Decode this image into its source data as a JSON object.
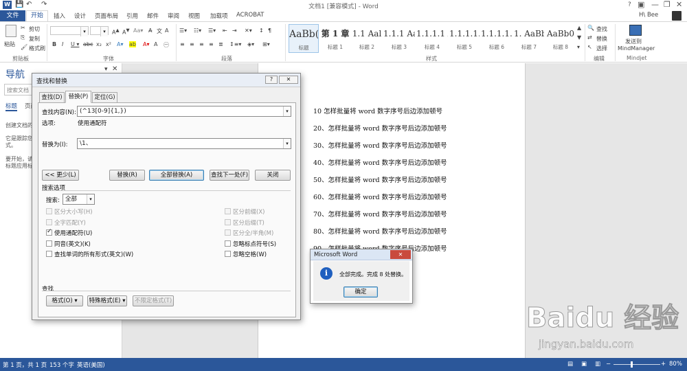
{
  "window": {
    "title": "文档1 [兼容模式] - Word",
    "help": "?",
    "user": "H\\ Bee"
  },
  "tabs": [
    "文件",
    "开始",
    "插入",
    "设计",
    "页面布局",
    "引用",
    "邮件",
    "审阅",
    "视图",
    "加载项",
    "ACROBAT"
  ],
  "ribbon": {
    "clipboard": {
      "paste": "粘贴",
      "cut": "剪切",
      "copy": "复制",
      "format_painter": "格式刷",
      "label": "剪贴板"
    },
    "font": {
      "size": "",
      "label": "字体"
    },
    "paragraph": {
      "label": "段落"
    },
    "styles": {
      "label": "样式",
      "items": [
        {
          "preview": "AaBb(",
          "name": "标题"
        },
        {
          "preview": "第 1 章",
          "name": "标题 1"
        },
        {
          "preview": "1.1 Aal",
          "name": "标题 2"
        },
        {
          "preview": "1.1.1 Aa",
          "name": "标题 3"
        },
        {
          "preview": "1.1.1.1 A",
          "name": "标题 4"
        },
        {
          "preview": "1.1.1.1.1",
          "name": "标题 5"
        },
        {
          "preview": "1.1.1.1.1.",
          "name": "标题 6"
        },
        {
          "preview": "1. AaBb(",
          "name": "标题 7"
        },
        {
          "preview": "AaBb0",
          "name": "标题 8"
        }
      ]
    },
    "editing": {
      "find": "查找",
      "replace": "替换",
      "select": "选择",
      "label": "编辑"
    },
    "mindjet": {
      "send": "发送到",
      "app": "MindManager",
      "label": "Mindjet"
    }
  },
  "nav": {
    "title": "导航",
    "search_placeholder": "搜索文档",
    "tabs": [
      "标题",
      "页面"
    ],
    "text1": "创建文档的",
    "text2": "它是跟踪您",
    "text3": "式。",
    "text4": "要开始，请",
    "text5": "标题应用标"
  },
  "document": {
    "lines": [
      "10 怎样批量将 word 数字序号后边添加顿号",
      "20、怎样批量将 word 数字序号后边添加顿号",
      "30、怎样批量将 word 数字序号后边添加顿号",
      "40、怎样批量将 word 数字序号后边添加顿号",
      "50、怎样批量将 word 数字序号后边添加顿号",
      "60、怎样批量将 word 数字序号后边添加顿号",
      "70、怎样批量将 word 数字序号后边添加顿号",
      "80、怎样批量将 word 数字序号后边添加顿号",
      "90、怎样批量将 word 数字序号后边添加顿号"
    ]
  },
  "find_replace": {
    "title": "查找和替换",
    "tabs": [
      "查找(D)",
      "替换(P)",
      "定位(G)"
    ],
    "find_label": "查找内容(N):",
    "find_value": "(^13[0-9]{1,})",
    "options_label": "选项:",
    "options_value": "使用通配符",
    "replace_label": "替换为(I):",
    "replace_value": "\\1、",
    "buttons": {
      "less": "<< 更少(L)",
      "replace": "替换(R)",
      "replace_all": "全部替换(A)",
      "find_next": "查找下一处(F)",
      "close": "关闭"
    },
    "search_options": "搜索选项",
    "search_label": "搜索:",
    "search_value": "全部",
    "left_checks": [
      {
        "label": "区分大小写(H)",
        "checked": false,
        "enabled": false
      },
      {
        "label": "全字匹配(Y)",
        "checked": false,
        "enabled": false
      },
      {
        "label": "使用通配符(U)",
        "checked": true,
        "enabled": true
      },
      {
        "label": "同音(英文)(K)",
        "checked": false,
        "enabled": true
      },
      {
        "label": "查找单词的所有形式(英文)(W)",
        "checked": false,
        "enabled": true
      }
    ],
    "right_checks": [
      {
        "label": "区分前缀(X)",
        "checked": false,
        "enabled": false
      },
      {
        "label": "区分后缀(T)",
        "checked": false,
        "enabled": false
      },
      {
        "label": "区分全/半角(M)",
        "checked": false,
        "enabled": false
      },
      {
        "label": "忽略标点符号(S)",
        "checked": false,
        "enabled": true
      },
      {
        "label": "忽略空格(W)",
        "checked": false,
        "enabled": true
      }
    ],
    "find_section": "查找",
    "bottom_buttons": [
      "格式(O) ▾",
      "特殊格式(E) ▾",
      "不限定格式(T)"
    ]
  },
  "msgbox": {
    "title": "Microsoft Word",
    "message": "全部完成。完成 8 处替换。",
    "ok": "确定"
  },
  "status": {
    "page": "第 1 页，共 1 页",
    "words": "153 个字",
    "lang": "英语(美国)",
    "zoom": "80%"
  },
  "watermark": {
    "brand": "Baidu 经验",
    "url": "jingyan.baidu.com"
  },
  "colors": {
    "accent": "#2b579a",
    "info_icon": "#1f5fbf"
  }
}
